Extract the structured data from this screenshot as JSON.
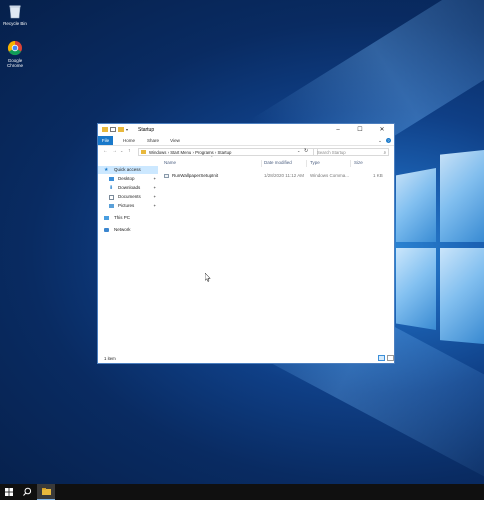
{
  "desktop": {
    "icons": [
      {
        "label": "Recycle Bin",
        "icon": "recycle-bin-icon"
      },
      {
        "label": "Google Chrome",
        "icon": "chrome-icon"
      }
    ]
  },
  "window": {
    "title": "Startup",
    "ribbon_tabs": [
      {
        "label": "File",
        "active": true
      },
      {
        "label": "Home"
      },
      {
        "label": "Share"
      },
      {
        "label": "View"
      }
    ],
    "address_path": "Windows  ›  Start Menu  ›  Programs  ›  Startup",
    "search_placeholder": "Search Startup",
    "sidebar": [
      {
        "label": "Quick access",
        "icon": "star-icon",
        "selected": true
      },
      {
        "label": "Desktop",
        "icon": "desktop-folder-icon",
        "pinned": true
      },
      {
        "label": "Downloads",
        "icon": "download-icon",
        "pinned": true
      },
      {
        "label": "Documents",
        "icon": "documents-icon",
        "pinned": true
      },
      {
        "label": "Pictures",
        "icon": "pictures-icon",
        "pinned": true
      },
      {
        "label": "This PC",
        "icon": "computer-icon"
      },
      {
        "label": "Network",
        "icon": "network-icon"
      }
    ],
    "columns": [
      "Name",
      "Date modified",
      "Type",
      "Size"
    ],
    "files": [
      {
        "name": "RunWallpaperSetupInit",
        "date": "1/28/2020 11:12 AM",
        "type": "Windows Comma...",
        "size": "1 KB"
      }
    ],
    "status": "1 item"
  },
  "taskbar": {
    "items": [
      "windows-start-icon",
      "search-icon",
      "file-explorer-icon"
    ]
  },
  "colors": {
    "accent": "#1979ca",
    "taskbar": "#101010",
    "window_border": "#4c7fbf"
  }
}
